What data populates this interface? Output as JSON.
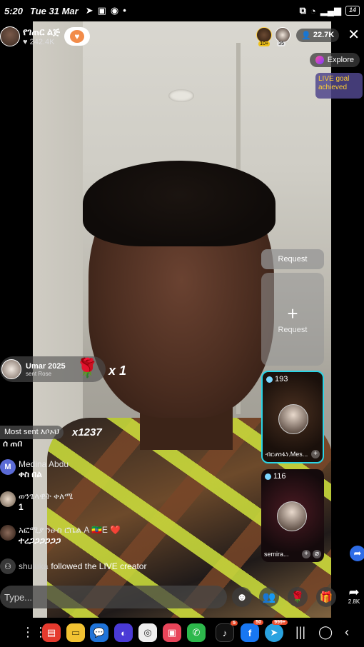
{
  "status_bar": {
    "time": "5:20",
    "date": "Tue 31 Mar",
    "battery": "14"
  },
  "host": {
    "name": "የገጠር ልጅ",
    "likes": "242.4K"
  },
  "viewers": {
    "badge_1": "10+",
    "badge_2": "35",
    "count": "22.7K"
  },
  "explore": {
    "label": "Explore"
  },
  "live_goal": {
    "text": "LIVE goal achieved"
  },
  "request": {
    "header": "Request",
    "slot_label": "Request",
    "plus": "+"
  },
  "guests": [
    {
      "count": "193",
      "name": "ብርሆሰፋነ.Mes..."
    },
    {
      "count": "116",
      "name": "semira..."
    }
  ],
  "gift_banner": {
    "user": "Umar  2025",
    "sub": "sent Rose",
    "multiplier": "x 1"
  },
  "most_sent": {
    "label": "Most sent እቦኦህ",
    "multiplier": "x1237"
  },
  "comments": [
    {
      "initial": "",
      "user": "",
      "text": "ሰ ጠበ"
    },
    {
      "initial": "M",
      "user": "Medina Abdu",
      "text": "ቀስ በል"
    },
    {
      "initial": "",
      "user": "ወንጌላዊት ቀለሜ",
      "text": "1"
    },
    {
      "initial": "",
      "user": "አፎሚያ ንፁስ ሮቤል A 🇪🇹E ❤️",
      "text": "ተረጋጋጋጋጋጋ"
    }
  ],
  "follow_event": {
    "user": "shuluka",
    "text": "followed the LIVE creator"
  },
  "input": {
    "placeholder": "Type..."
  },
  "share": {
    "count": "2.8K"
  },
  "dock": {
    "tiktok_badge": "5",
    "facebook_badge": "50",
    "telegram_badge": "999+"
  },
  "icons": {
    "close": "close-icon",
    "emoji": "emoji-icon",
    "people": "multi-guest-icon",
    "rose": "rose-gift-icon",
    "gift": "gift-box-icon",
    "share": "share-arrow-icon"
  }
}
